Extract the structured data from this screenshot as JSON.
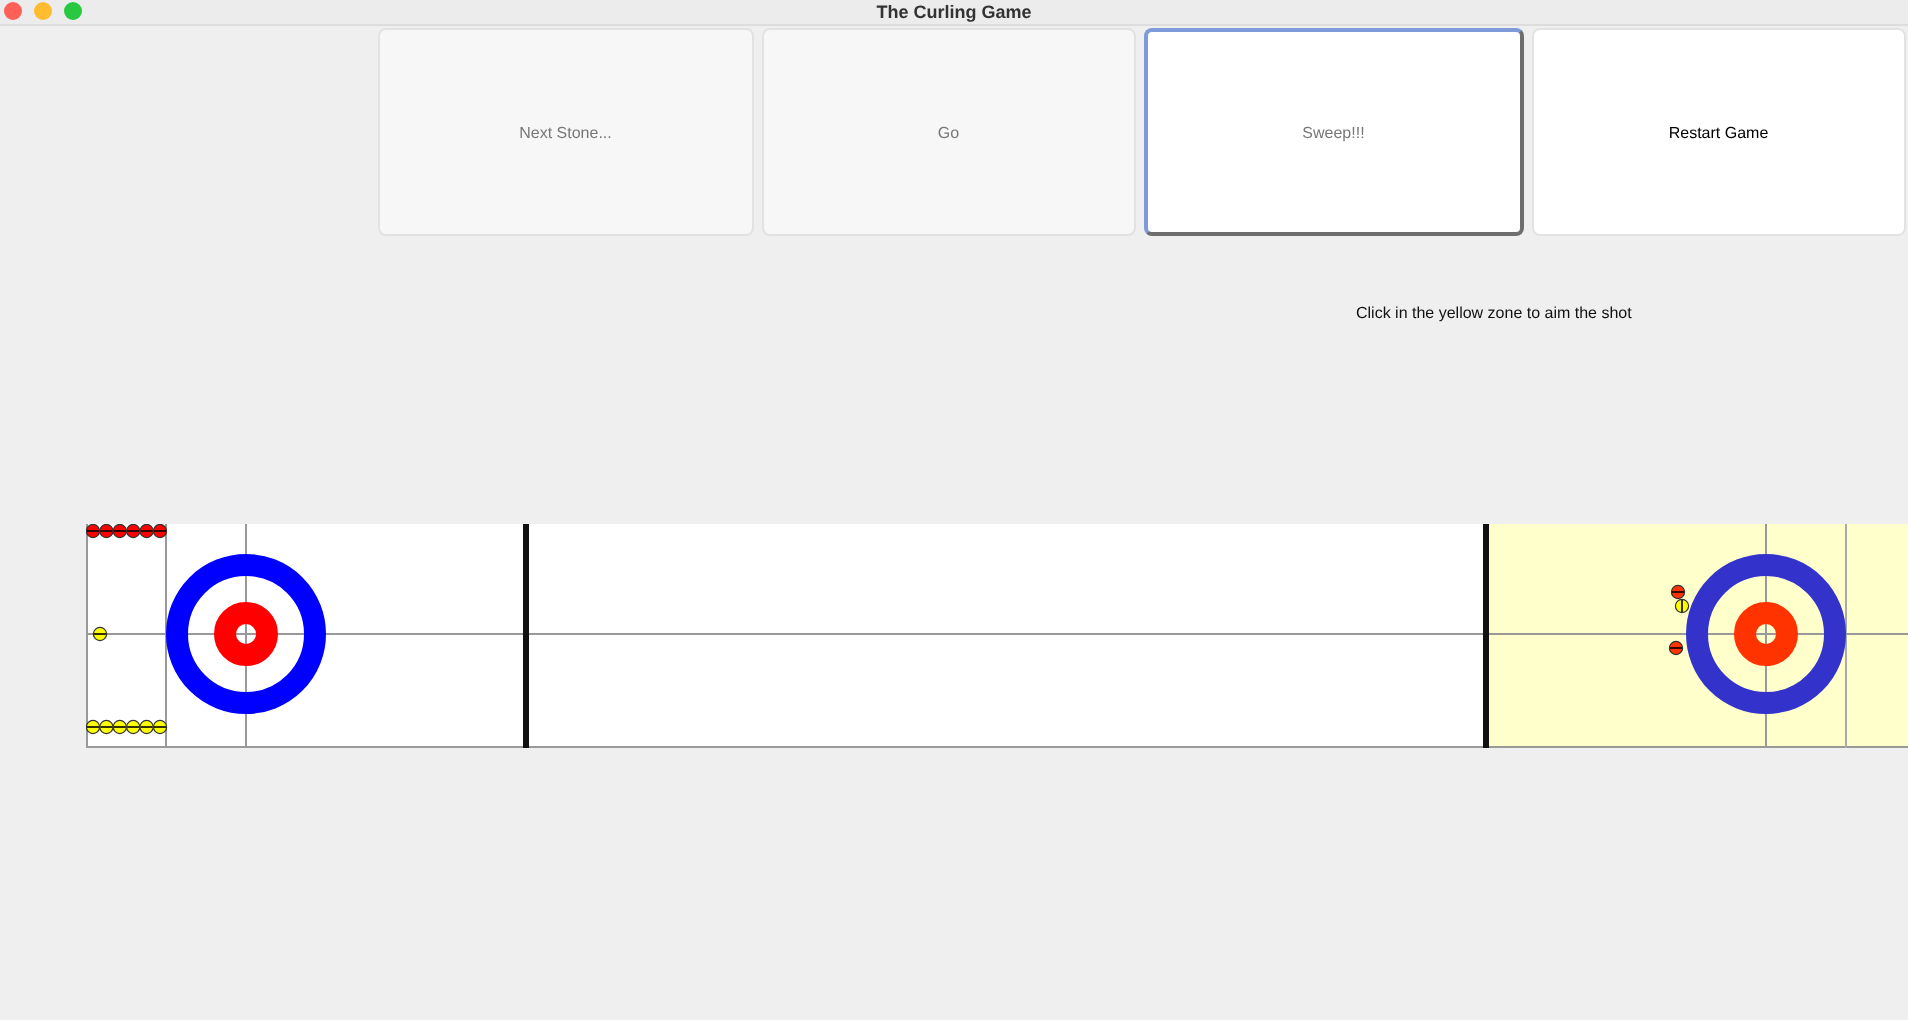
{
  "window": {
    "title": "The Curling Game"
  },
  "buttons": [
    {
      "label": "Next Stone...",
      "disabled": true,
      "focused": false
    },
    {
      "label": "Go",
      "disabled": true,
      "focused": false
    },
    {
      "label": "Sweep!!!",
      "disabled": true,
      "focused": true
    },
    {
      "label": "Restart Game",
      "disabled": false,
      "focused": false
    }
  ],
  "message": "Click in the yellow zone to aim the shot"
}
